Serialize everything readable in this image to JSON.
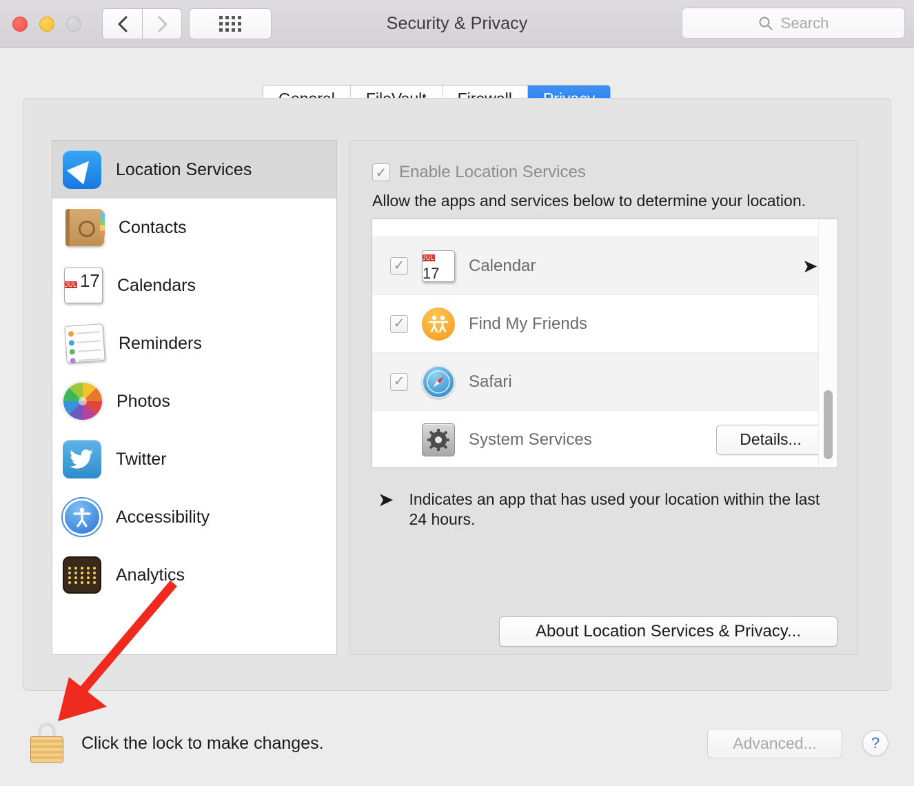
{
  "window": {
    "title": "Security & Privacy",
    "traffic_lights": [
      "close",
      "minimize",
      "zoom-disabled"
    ],
    "nav": {
      "back_icon": "chevron-left-icon",
      "forward_icon": "chevron-right-icon"
    },
    "grid_button_icon": "show-all-grid-icon"
  },
  "search": {
    "placeholder": "Search",
    "value": "",
    "icon": "search-icon"
  },
  "tabs": [
    {
      "label": "General",
      "active": false
    },
    {
      "label": "FileVault",
      "active": false
    },
    {
      "label": "Firewall",
      "active": false
    },
    {
      "label": "Privacy",
      "active": true
    }
  ],
  "accent_color": "#1f79ef",
  "sidebar": {
    "items": [
      {
        "label": "Location Services",
        "icon": "location-services-icon",
        "selected": true
      },
      {
        "label": "Contacts",
        "icon": "contacts-icon",
        "selected": false
      },
      {
        "label": "Calendars",
        "icon": "calendar-icon",
        "selected": false
      },
      {
        "label": "Reminders",
        "icon": "reminders-icon",
        "selected": false
      },
      {
        "label": "Photos",
        "icon": "photos-icon",
        "selected": false
      },
      {
        "label": "Twitter",
        "icon": "twitter-icon",
        "selected": false
      },
      {
        "label": "Accessibility",
        "icon": "accessibility-icon",
        "selected": false
      },
      {
        "label": "Analytics",
        "icon": "analytics-icon",
        "selected": false
      }
    ]
  },
  "calendar_icon": {
    "month": "JUL",
    "day": "17"
  },
  "detail": {
    "enable_checkbox": {
      "label": "Enable Location Services",
      "checked": true,
      "disabled": true
    },
    "subtitle": "Allow the apps and services below to determine your location.",
    "app_rows": [
      {
        "name": "Calendar",
        "icon": "calendar-icon",
        "checked": true,
        "recent_use": true
      },
      {
        "name": "Find My Friends",
        "icon": "find-my-friends-icon",
        "checked": true,
        "recent_use": false
      },
      {
        "name": "Safari",
        "icon": "safari-icon",
        "checked": true,
        "recent_use": false
      },
      {
        "name": "System Services",
        "icon": "system-services-icon",
        "checked": null,
        "recent_use": false,
        "button": "Details..."
      }
    ],
    "legend": {
      "icon": "location-arrow-icon",
      "text": "Indicates an app that has used your location within the last 24 hours."
    },
    "about_button": "About Location Services & Privacy..."
  },
  "footer": {
    "lock_icon": "lock-closed-icon",
    "lock_text": "Click the lock to make changes.",
    "advanced_button": {
      "label": "Advanced...",
      "disabled": true
    },
    "help_button": "?"
  },
  "annotation": {
    "type": "red-arrow",
    "color": "#ef2a1e"
  }
}
